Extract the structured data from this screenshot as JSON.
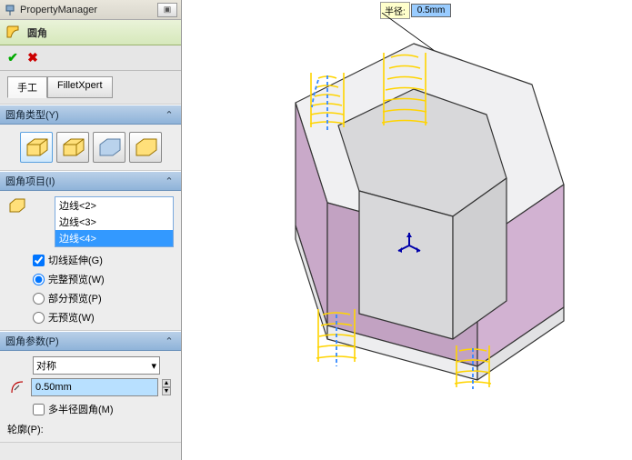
{
  "pm": {
    "title": "PropertyManager"
  },
  "feature": {
    "name": "圆角"
  },
  "tabs": {
    "manual": "手工",
    "xpert": "FilletXpert"
  },
  "sections": {
    "type": {
      "title": "圆角类型(Y)"
    },
    "items": {
      "title": "圆角项目(I)",
      "list": [
        "边线<2>",
        "边线<3>",
        "边线<4>"
      ],
      "tangent": "切线延伸(G)",
      "full_preview": "完整预览(W)",
      "partial_preview": "部分预览(P)",
      "no_preview": "无预览(W)"
    },
    "params": {
      "title": "圆角参数(P)",
      "symmetry": "对称",
      "radius_value": "0.50mm",
      "multi_radius": "多半径圆角(M)",
      "profile_label": "轮廓(P):"
    }
  },
  "callout": {
    "label": "半径:",
    "value": "0.5mm"
  }
}
